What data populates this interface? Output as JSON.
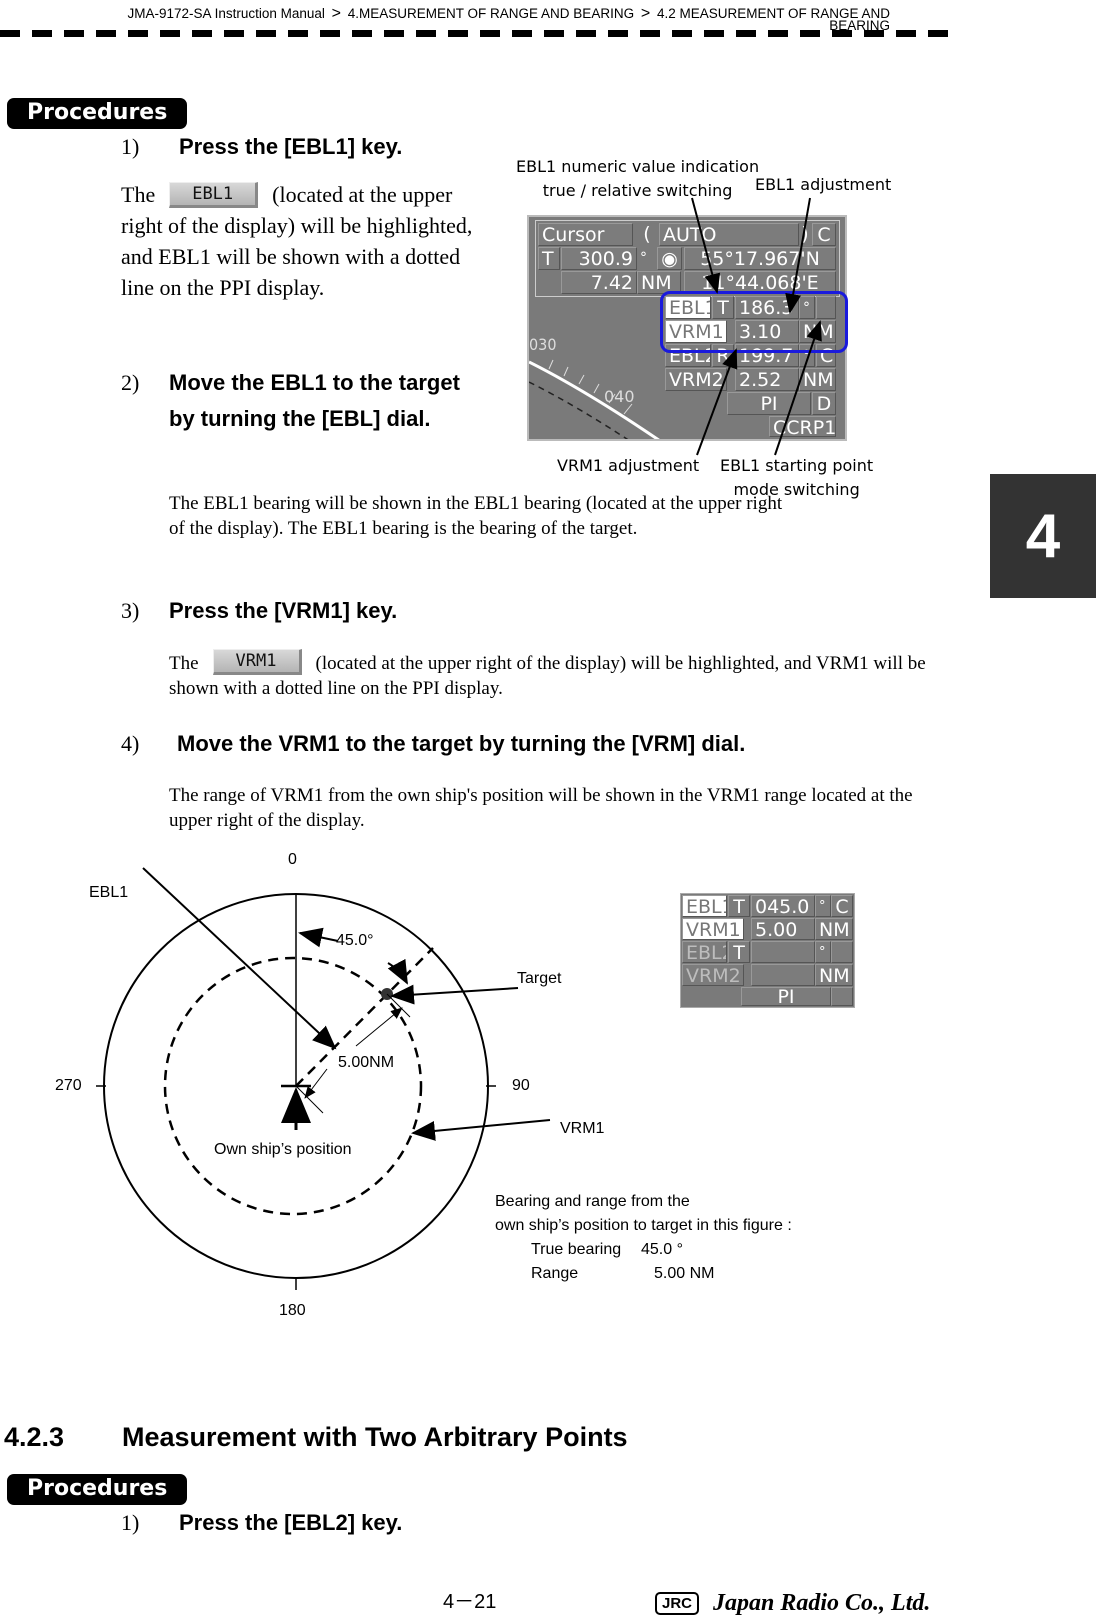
{
  "header": {
    "breadcrumb": [
      "JMA-9172-SA Instruction Manual",
      "4.MEASUREMENT OF RANGE AND BEARING",
      "4.2  MEASUREMENT OF RANGE AND"
    ],
    "breadcrumb_wrap": "BEARING",
    "separator": ">"
  },
  "chapter_tab": "4",
  "procedures_label": "Procedures",
  "steps": [
    {
      "num": "1)",
      "title": "Press the [EBL1] key.",
      "text_before": "The",
      "key": "EBL1",
      "text_after": "(located at the upper right of the display) will be highlighted, and EBL1 will be shown with a dotted line on the PPI display."
    },
    {
      "num": "2)",
      "title": "Move the EBL1 to the target by turning the [EBL] dial.",
      "text": "The EBL1 bearing will be shown in the EBL1 bearing (located at the upper right of the display). The EBL1 bearing is the bearing of the target."
    },
    {
      "num": "3)",
      "title": "Press the [VRM1] key.",
      "text_before": "The",
      "key": "VRM1",
      "text_after": "(located at the upper right of the display) will be highlighted, and VRM1 will be shown with a dotted line on the PPI display."
    },
    {
      "num": "4)",
      "title": "Move the VRM1 to the target by turning the [VRM] dial.",
      "text": "The range of VRM1 from the own ship's position will be shown in the VRM1 range located at the upper right of the display."
    }
  ],
  "radar_panel": {
    "callouts": {
      "true_relative": "EBL1 numeric value indication\ntrue / relative switching",
      "ebl1_adjust": "EBL1 adjustment",
      "vrm1_adjust": "VRM1 adjustment",
      "start_point": "EBL1 starting point\nmode switching"
    },
    "cursor": {
      "label": "Cursor",
      "open": "(",
      "mode": "AUTO",
      "close": ")",
      "c": "C",
      "t": "T",
      "bearing": "300.9",
      "deg": "°",
      "range": "7.42",
      "nm": "NM",
      "lat": "55°17.967'N",
      "lon": "11°44.068'E"
    },
    "ebl1": {
      "label": "EBL1",
      "mode": "T",
      "value": "186.3",
      "unit": "°"
    },
    "vrm1": {
      "label": "VRM1",
      "value": "3.10",
      "unit": "NM"
    },
    "ebl2": {
      "label": "EBL2",
      "mode": "R",
      "value": "199.7",
      "unit": "°",
      "c": "C"
    },
    "vrm2": {
      "label": "VRM2",
      "value": "2.52",
      "unit": "NM"
    },
    "pi": "PI",
    "d": "D",
    "ccrp": "CCRP1",
    "scale_030": "030",
    "scale_040": "040",
    "highlight_color": "#1a1adc"
  },
  "diagram": {
    "north": "0",
    "east": "90",
    "south": "180",
    "west": "270",
    "ebl1_label": "EBL1",
    "target_label": "Target",
    "vrm1_label": "VRM1",
    "angle_label": "45.0°",
    "range_label": "5.00NM",
    "own_ship_label": "Own ship’s position",
    "bearing_deg": 45.0,
    "range_nm": 5.0
  },
  "mini_panel": {
    "ebl1": {
      "label": "EBL1",
      "mode": "T",
      "value": "045.0",
      "unit": "°",
      "c": "C"
    },
    "vrm1": {
      "label": "VRM1",
      "value": "5.00",
      "unit": "NM"
    },
    "ebl2": {
      "label": "EBL2",
      "mode": "T",
      "unit": "°"
    },
    "vrm2": {
      "label": "VRM2",
      "unit": "NM"
    },
    "pi": "PI"
  },
  "summary": {
    "line1": "Bearing and range from the",
    "line2": "own ship’s position to target in this figure :",
    "bearing_label": "True bearing",
    "bearing_value": "45.0 °",
    "range_label": "Range",
    "range_value": "5.00 NM"
  },
  "section": {
    "number": "4.2.3",
    "title": "Measurement with Two Arbitrary Points"
  },
  "section_step": {
    "num": "1)",
    "title": "Press the [EBL2] key."
  },
  "footer": {
    "page": "4－21",
    "logo": "JRC",
    "company": "Japan Radio Co., Ltd."
  }
}
